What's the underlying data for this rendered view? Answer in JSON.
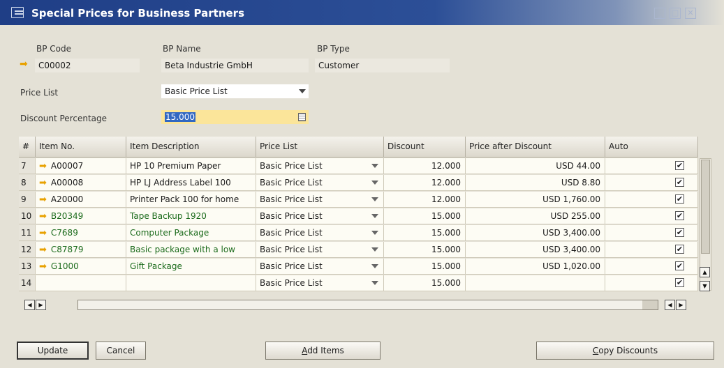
{
  "window": {
    "title": "Special Prices for Business Partners",
    "controls": [
      "minimize-icon",
      "maximize-icon",
      "close-icon"
    ]
  },
  "header": {
    "bp_code_label": "BP Code",
    "bp_code": "C00002",
    "bp_name_label": "BP Name",
    "bp_name": "Beta Industrie GmbH",
    "bp_type_label": "BP Type",
    "bp_type": "Customer",
    "price_list_label": "Price List",
    "price_list": "Basic Price List",
    "discount_label": "Discount Percentage",
    "discount": "15.000"
  },
  "grid": {
    "columns": [
      "#",
      "Item No.",
      "Item Description",
      "Price List",
      "Discount",
      "Price after Discount",
      "Auto"
    ],
    "rows": [
      {
        "n": "7",
        "item": "A00007",
        "desc": "HP 10 Premium Paper",
        "price_list": "Basic Price List",
        "discount": "12.000",
        "price": "USD 44.00",
        "auto": true,
        "green": false
      },
      {
        "n": "8",
        "item": "A00008",
        "desc": "HP LJ Address Label 100",
        "price_list": "Basic Price List",
        "discount": "12.000",
        "price": "USD 8.80",
        "auto": true,
        "green": false
      },
      {
        "n": "9",
        "item": "A20000",
        "desc": "Printer Pack 100 for home",
        "price_list": "Basic Price List",
        "discount": "12.000",
        "price": "USD 1,760.00",
        "auto": true,
        "green": false
      },
      {
        "n": "10",
        "item": "B20349",
        "desc": "Tape Backup 1920",
        "price_list": "Basic Price List",
        "discount": "15.000",
        "price": "USD 255.00",
        "auto": true,
        "green": true
      },
      {
        "n": "11",
        "item": "C7689",
        "desc": "Computer Package",
        "price_list": "Basic Price List",
        "discount": "15.000",
        "price": "USD 3,400.00",
        "auto": true,
        "green": true
      },
      {
        "n": "12",
        "item": "C87879",
        "desc": "Basic package with a low",
        "price_list": "Basic Price List",
        "discount": "15.000",
        "price": "USD 3,400.00",
        "auto": true,
        "green": true
      },
      {
        "n": "13",
        "item": "G1000",
        "desc": "Gift Package",
        "price_list": "Basic Price List",
        "discount": "15.000",
        "price": "USD 1,020.00",
        "auto": true,
        "green": true
      },
      {
        "n": "14",
        "item": "",
        "desc": "",
        "price_list": "Basic Price List",
        "discount": "15.000",
        "price": "",
        "auto": true,
        "green": false
      }
    ]
  },
  "buttons": {
    "update": "Update",
    "cancel": "Cancel",
    "add_items_u": "A",
    "add_items_rest": "dd Items",
    "copy_u": "C",
    "copy_rest": "opy Discounts"
  },
  "colors": {
    "title_bar": "#1f3e86",
    "link_arrow": "#e8a100",
    "green_text": "#1c6b1c",
    "highlight_field": "#fbe59a"
  }
}
